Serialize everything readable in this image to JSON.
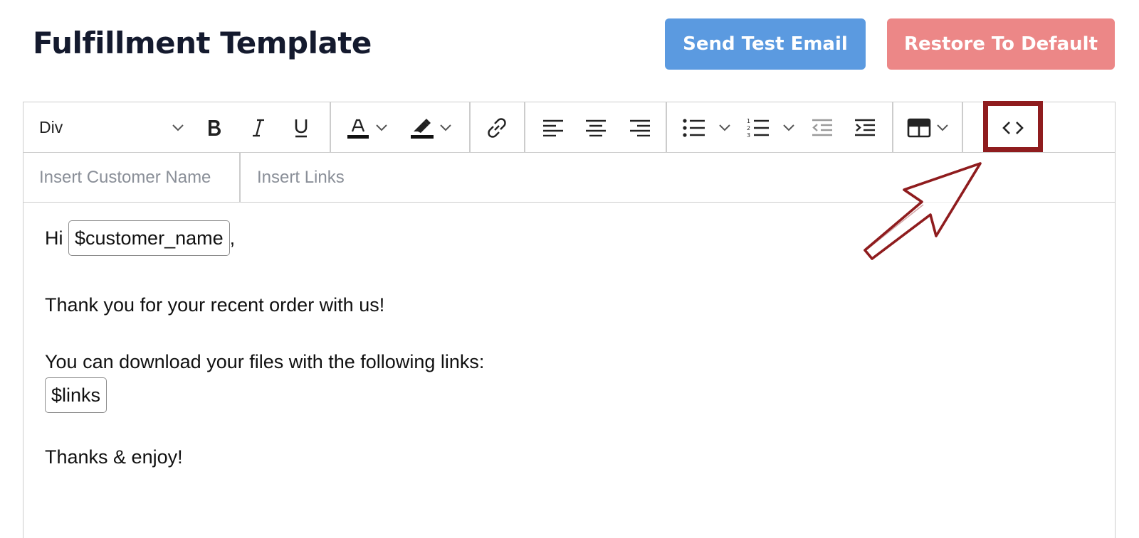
{
  "header": {
    "title": "Fulfillment Template",
    "send_test_label": "Send Test Email",
    "restore_label": "Restore To Default"
  },
  "toolbar": {
    "block_format": "Div",
    "icons": [
      "bold-icon",
      "italic-icon",
      "underline-icon",
      "text-color-icon",
      "highlight-color-icon",
      "link-icon",
      "align-left-icon",
      "align-center-icon",
      "align-right-icon",
      "bullet-list-icon",
      "numbered-list-icon",
      "outdent-icon",
      "indent-icon",
      "table-icon",
      "source-code-icon"
    ],
    "accent_highlight": "#8f1c1e"
  },
  "insert_bar": {
    "customer_name": "Insert Customer Name",
    "links": "Insert Links"
  },
  "body": {
    "greeting_prefix": "Hi",
    "customer_tag": "$customer_name",
    "greeting_suffix": ",",
    "line1": "Thank you for your recent order with us!",
    "line2": "You can download your files with the following links:",
    "links_tag": "$links",
    "line3": "Thanks & enjoy!"
  },
  "colors": {
    "send_test": "#5b9ae0",
    "restore": "#ec8787",
    "title": "#141a2e"
  }
}
